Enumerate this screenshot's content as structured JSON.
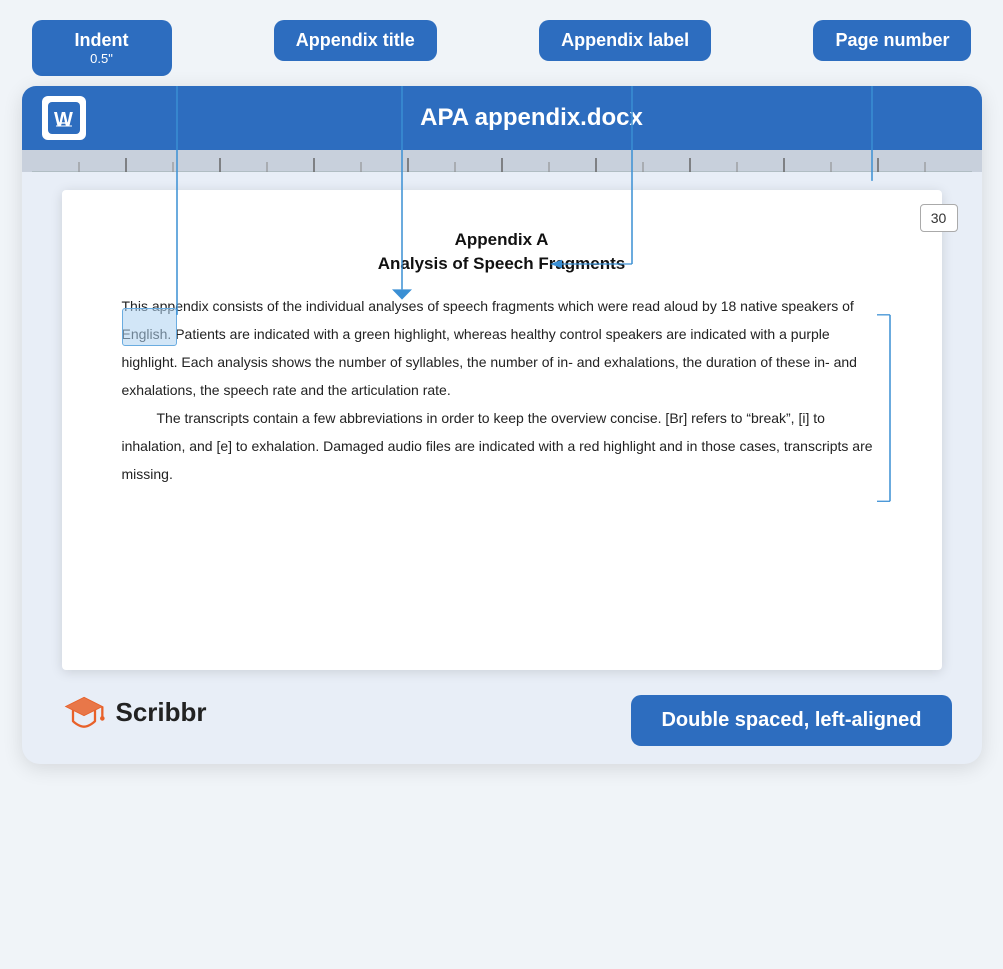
{
  "labels": {
    "indent": "Indent",
    "indent_sub": "0.5\"",
    "appendix_title": "Appendix title",
    "appendix_label": "Appendix label",
    "page_number_label": "Page number"
  },
  "header": {
    "filename": "APA appendix.docx"
  },
  "page_number": "30",
  "document": {
    "appendix_label": "Appendix A",
    "appendix_title": "Analysis of Speech Fragments",
    "paragraph1": "This appendix consists of the individual analyses of speech fragments which were read aloud by 18 native speakers of English. Patients are indicated with a green highlight, whereas healthy control speakers are indicated with a purple highlight. Each analysis shows the number of syllables, the number of in- and exhalations, the duration of these in- and exhalations, the speech rate and the articulation rate.",
    "paragraph2": "The transcripts contain a few abbreviations in order to keep the overview concise. [Br] refers to “break”, [i] to inhalation, and [e] to exhalation. Damaged audio files are indicated with a red highlight and in those cases, transcripts are missing."
  },
  "branding": {
    "name": "Scribbr"
  },
  "bottom_badge": "Double spaced, left-aligned",
  "colors": {
    "accent": "#2d6dbf",
    "white": "#ffffff"
  }
}
